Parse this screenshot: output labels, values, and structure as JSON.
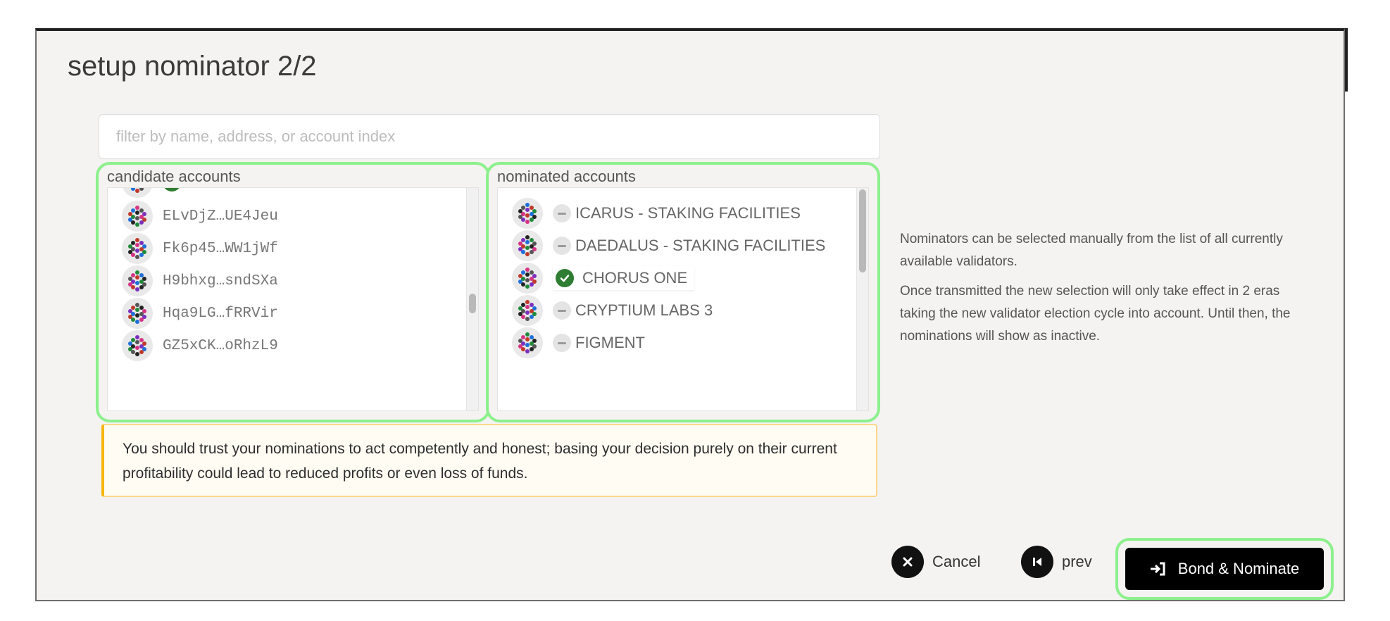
{
  "modal": {
    "title": "setup nominator 2/2"
  },
  "filter": {
    "placeholder": "filter by name, address, or account index"
  },
  "candidates": {
    "label": "candidate accounts",
    "items": [
      {
        "name": "ELvDjZ…UE4Jeu"
      },
      {
        "name": "Fk6p45…WW1jWf"
      },
      {
        "name": "H9bhxg…sndSXa"
      },
      {
        "name": "Hqa9LG…fRRVir"
      },
      {
        "name": "GZ5xCK…oRhzL9"
      }
    ],
    "scroll_position": 0.5
  },
  "nominated": {
    "label": "nominated accounts",
    "items": [
      {
        "name": "ICARUS - STAKING FACILITIES",
        "status": "inactive"
      },
      {
        "name": "DAEDALUS - STAKING FACILITIES",
        "status": "inactive"
      },
      {
        "name": "CHORUS ONE",
        "status": "active"
      },
      {
        "name": "CRYPTIUM LABS 3",
        "status": "inactive"
      },
      {
        "name": "FIGMENT",
        "status": "inactive"
      }
    ],
    "scroll_position": 0.0
  },
  "warning": "You should trust your nominations to act competently and honest; basing your decision purely on their current profitability could lead to reduced profits or even loss of funds.",
  "info": {
    "p1": "Nominators can be selected manually from the list of all currently available validators.",
    "p2": "Once transmitted the new selection will only take effect in 2 eras taking the new validator election cycle into account. Until then, the nominations will show as inactive."
  },
  "buttons": {
    "cancel": "Cancel",
    "prev": "prev",
    "bond": "Bond & Nominate"
  },
  "colors": {
    "highlight": "#8cf08c",
    "active_status": "#2e7d32",
    "warning_border": "#f5b60f",
    "primary_button": "#000000"
  },
  "icons": {
    "cancel": "close-icon",
    "prev": "step-back-icon",
    "bond": "sign-in-icon",
    "active": "check-icon",
    "inactive": "minus-icon",
    "avatar": "identicon"
  }
}
